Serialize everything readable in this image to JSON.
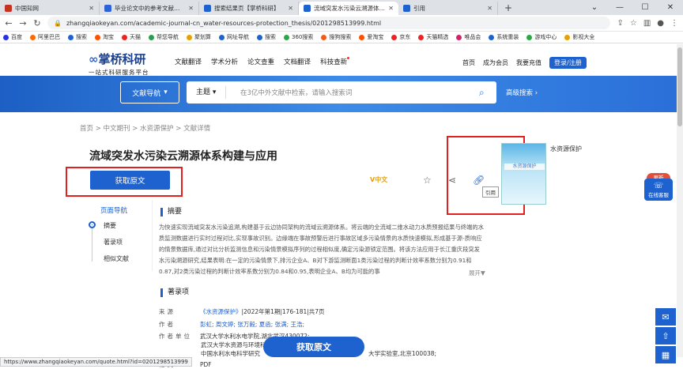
{
  "browser": {
    "tabs": [
      {
        "title": "中国知网",
        "color": "#c6321f"
      },
      {
        "title": "毕业论文中的参考文献怎么引用",
        "color": "#2d63d8"
      },
      {
        "title": "搜索结果页【掌桥科研】",
        "color": "#1e62d0"
      },
      {
        "title": "流域突发水污染云溯源体系构建与",
        "color": "#1e62d0"
      },
      {
        "title": "引用",
        "color": "#1e62d0"
      }
    ],
    "new_tab": "+",
    "url": "zhangqiaokeyan.com/academic-journal-cn_water-resources-protection_thesis/0201298513999.html",
    "bookmarks": [
      "百度",
      "阿里巴巴",
      "搜索",
      "淘宝",
      "天猫",
      "帮您导航",
      "聚划算",
      "网址导航",
      "搜索",
      "360搜索",
      "搜狗搜索",
      "爱淘宝",
      "京东",
      "天猫精选",
      "唯品会",
      "系统重装",
      "游戏中心",
      "影视大全"
    ],
    "bookmark_colors": [
      "#2932e1",
      "#ff6a00",
      "#1e62d0",
      "#ff5000",
      "#e22",
      "#2a9d4a",
      "#e8a000",
      "#1e62d0",
      "#1e62d0",
      "#2aa847",
      "#f25b1d",
      "#ff5000",
      "#e22",
      "#e22",
      "#d6216a",
      "#1e62d0",
      "#2aa847",
      "#e8a000"
    ]
  },
  "site": {
    "logo_text": "掌桥科研",
    "logo_sub": "一站式科研服务平台",
    "nav": [
      "文献翻译",
      "学术分析",
      "论文查重",
      "文档翻译",
      "科技查新"
    ],
    "user_nav": [
      "首页",
      "成为会员",
      "我要充值"
    ],
    "login": "登录/注册",
    "doc_nav": "文献导航",
    "search_select": "主题",
    "search_placeholder": "在3亿中外文献中检索，请输入搜索词",
    "advanced": "高级搜索"
  },
  "breadcrumb": "首页 > 中文期刊 > 水资源保护 > 文献详情",
  "article": {
    "title": "流域突发水污染云溯源体系构建与应用",
    "get_btn": "获取原文",
    "lang_badge": "中文",
    "tooltip": "引用",
    "journal_name": "水资源保护",
    "cover_title": "水资源保护"
  },
  "sidenav": {
    "heading": "页面导航",
    "items": [
      "摘要",
      "著录项",
      "相似文献"
    ]
  },
  "abstract": {
    "heading": "摘要",
    "text": "为快速实现流域突发水污染追溯,构建基于云边协同架构的流域云溯源体系。将云端的全流域二维水动力水质预报结果与终端的水质监测数据进行实时过程对比,实现事故识别。边缘端在事故预警后进行事故区域多污染情景的水质快速模拟,形成基于源-质响应的情景数据库,通过对比分析监测信息和污染情景模拟序列的过程相似度,确定污染源锁定范围。将该方法应用于长江重庆段突发水污染溯源研究,结果表明:在一定的污染情景下,排污企业A、B对下游监测断面1类污染过程的判断计效率系数分别为0.91和0.87,对2类污染过程的判断计效率系数分别为0.84和0.95,表明企业A、B均为可能的事",
    "expand": "展开▼"
  },
  "meta": {
    "heading": "著录项",
    "source_key": "来源",
    "source_link": "《水资源保护》",
    "source_rest": "|2022年第1期|176-181|共7页",
    "author_key": "作者",
    "authors": "彭虹; 周文婷; 张万毅; 夏函; 张满; 王浩;",
    "unit_key": "作者单位",
    "units": [
      "武汉大学水利水电学院,湖北武汉430072;",
      "武汉大学水资源与环境科",
      "中国水利水电科学研究",
      "大学实验室,北京100038;"
    ],
    "format_key": "格式",
    "format": "PDF"
  },
  "float_btn": "获取原文",
  "status_url": "https://www.zhangqiaokeyan.com/quote.html?id=0201298513999",
  "helper": {
    "label": "在线客服",
    "badge": "更新"
  }
}
